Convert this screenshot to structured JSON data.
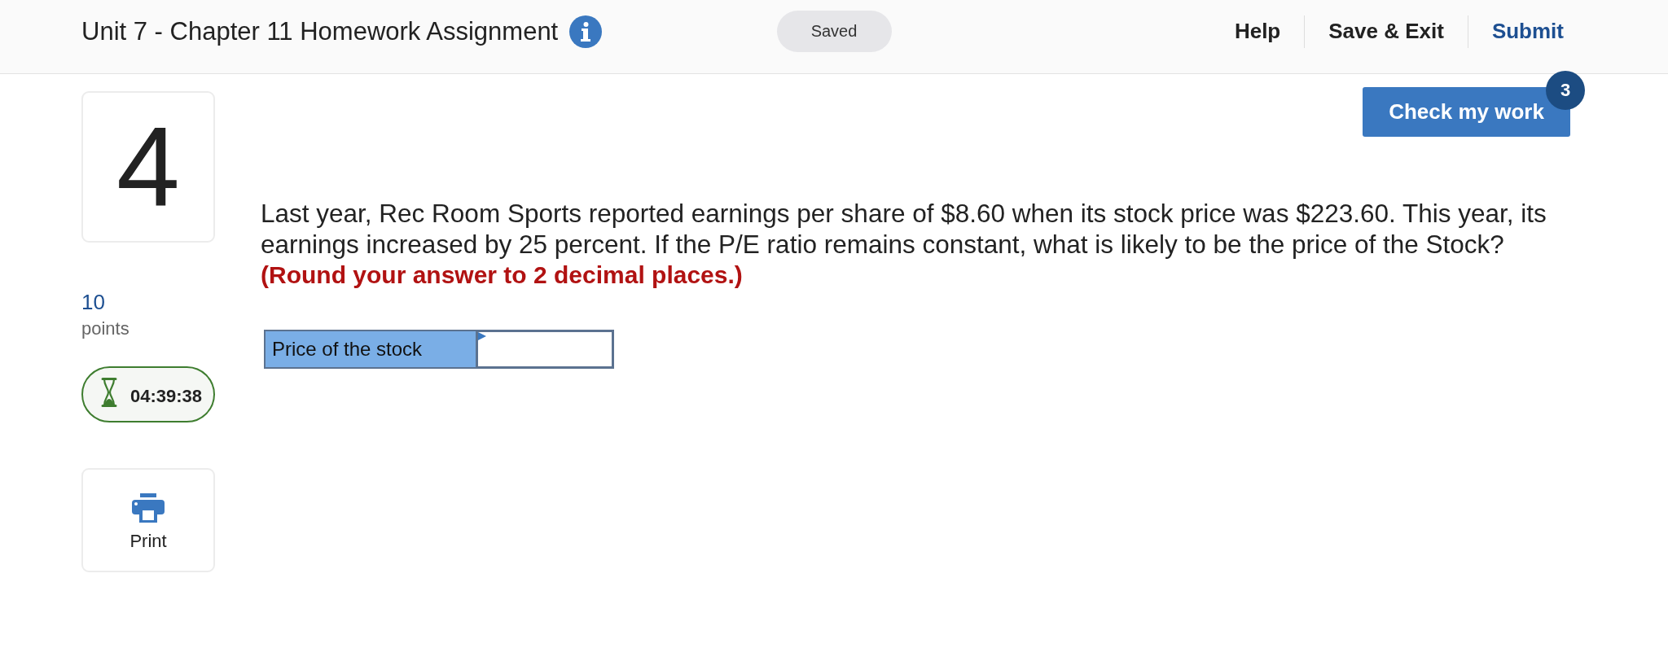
{
  "header": {
    "title": "Unit 7 - Chapter 11 Homework Assignment",
    "save_status": "Saved",
    "links": [
      {
        "label": "Help",
        "kind": "plain"
      },
      {
        "label": "Save & Exit",
        "kind": "plain"
      },
      {
        "label": "Submit",
        "kind": "primary"
      }
    ]
  },
  "check_button": {
    "label": "Check my work",
    "badge": "3"
  },
  "question": {
    "number": "4",
    "points": "10",
    "points_label": "points",
    "timer": "04:39:38",
    "print_label": "Print"
  },
  "prompt": {
    "text": "Last year, Rec Room Sports reported earnings per share of $8.60 when its stock price was $223.60. This year, its earnings increased by 25 percent. If the P/E ratio remains constant, what is likely to be the price of the Stock?",
    "instruction": "(Round your answer to 2 decimal places.)"
  },
  "answer_table": {
    "rows": [
      {
        "label": "Price of the stock"
      }
    ]
  }
}
